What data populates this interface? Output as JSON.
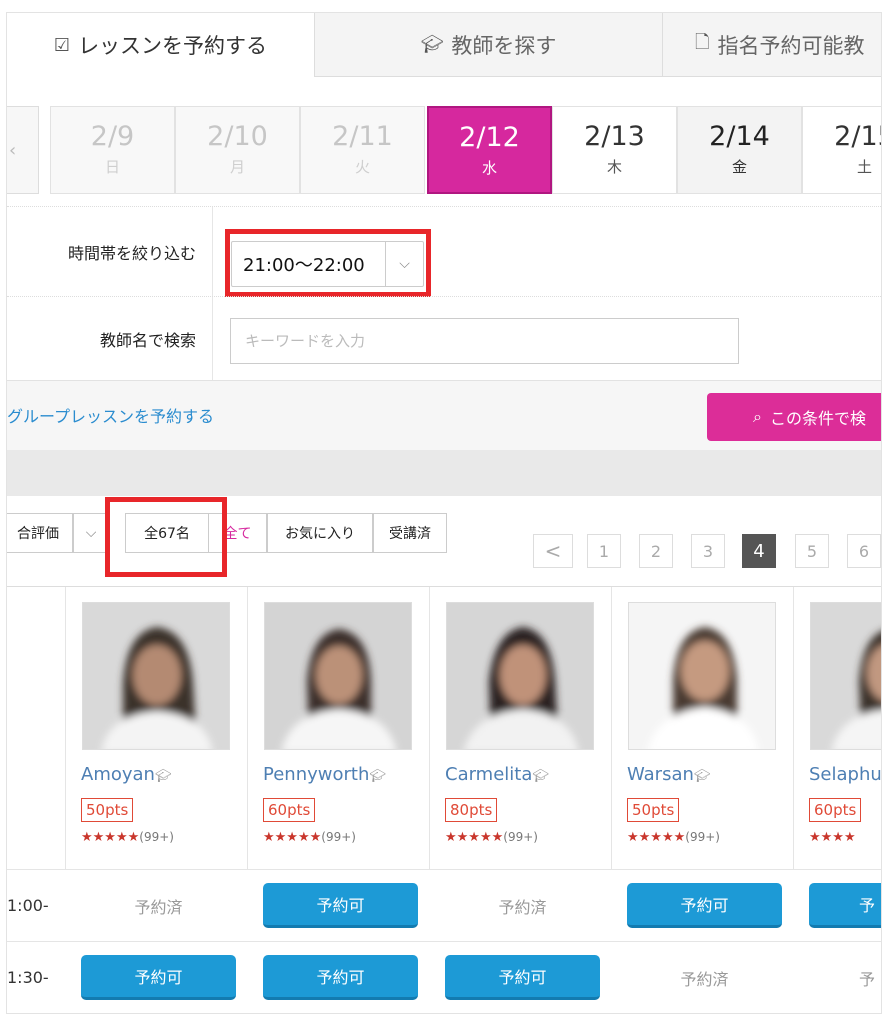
{
  "tabs": [
    {
      "label": "レッスンを予約する",
      "icon": "calendar-check-icon"
    },
    {
      "label": "教師を探す",
      "icon": "graduation-cap-icon"
    },
    {
      "label": "指名予約可能教",
      "icon": "document-icon"
    }
  ],
  "dates": [
    {
      "date": "2/9",
      "weekday": "日"
    },
    {
      "date": "2/10",
      "weekday": "月"
    },
    {
      "date": "2/11",
      "weekday": "火"
    },
    {
      "date": "2/12",
      "weekday": "水"
    },
    {
      "date": "2/13",
      "weekday": "木"
    },
    {
      "date": "2/14",
      "weekday": "金"
    },
    {
      "date": "2/15",
      "weekday": "土"
    }
  ],
  "selected_date": "2/12",
  "filters": {
    "time_label": "時間帯を絞り込む",
    "time_value": "21:00〜22:00",
    "name_label": "教師名で検索",
    "name_placeholder": "キーワードを入力",
    "group_link": "グループレッスンを予約する",
    "search_button": "この条件で検"
  },
  "sort": {
    "rating": "合評価",
    "total": "全67名",
    "all": "全て",
    "favorites": "お気に入り",
    "taken": "受講済"
  },
  "pager": {
    "prev": "<",
    "pages": [
      "1",
      "2",
      "3",
      "4",
      "5",
      "6"
    ],
    "current": "4"
  },
  "teachers": [
    {
      "name": "Amoyan",
      "pts": "50pts",
      "stars": "★★★★★",
      "count": "(99+)"
    },
    {
      "name": "Pennyworth",
      "pts": "60pts",
      "stars": "★★★★★",
      "count": "(99+)"
    },
    {
      "name": "Carmelita",
      "pts": "80pts",
      "stars": "★★★★★",
      "count": "(99+)"
    },
    {
      "name": "Warsan",
      "pts": "50pts",
      "stars": "★★★★★",
      "count": "(99+)"
    },
    {
      "name": "Selaphu",
      "pts": "60pts",
      "stars": "★★★★",
      "count": ""
    }
  ],
  "slots": [
    {
      "time": "1:00-",
      "status": [
        "予約済",
        "予約可",
        "予約済",
        "予約可",
        "予"
      ]
    },
    {
      "time": "1:30-",
      "status": [
        "予約可",
        "予約可",
        "予約可",
        "予約済",
        "予"
      ]
    }
  ],
  "colors": {
    "accent": "#d6289e",
    "book": "#1d9ad6",
    "highlight": "#e8262a",
    "name": "#4e7fb3"
  }
}
